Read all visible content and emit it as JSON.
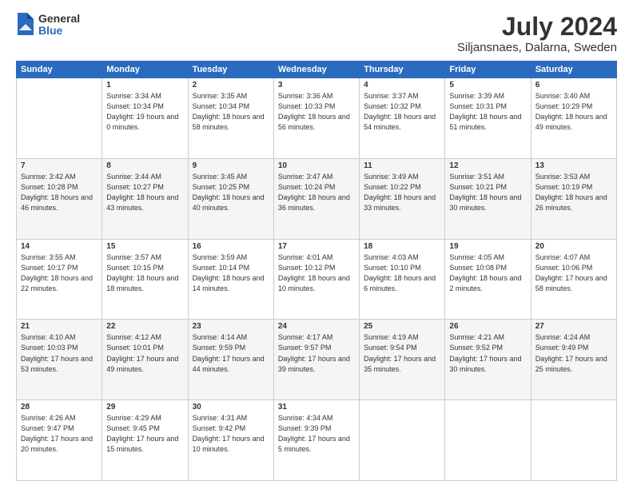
{
  "logo": {
    "general": "General",
    "blue": "Blue"
  },
  "header": {
    "title": "July 2024",
    "subtitle": "Siljansnaes, Dalarna, Sweden"
  },
  "weekdays": [
    "Sunday",
    "Monday",
    "Tuesday",
    "Wednesday",
    "Thursday",
    "Friday",
    "Saturday"
  ],
  "weeks": [
    [
      {
        "day": "",
        "sunrise": "",
        "sunset": "",
        "daylight": ""
      },
      {
        "day": "1",
        "sunrise": "Sunrise: 3:34 AM",
        "sunset": "Sunset: 10:34 PM",
        "daylight": "Daylight: 19 hours and 0 minutes."
      },
      {
        "day": "2",
        "sunrise": "Sunrise: 3:35 AM",
        "sunset": "Sunset: 10:34 PM",
        "daylight": "Daylight: 18 hours and 58 minutes."
      },
      {
        "day": "3",
        "sunrise": "Sunrise: 3:36 AM",
        "sunset": "Sunset: 10:33 PM",
        "daylight": "Daylight: 18 hours and 56 minutes."
      },
      {
        "day": "4",
        "sunrise": "Sunrise: 3:37 AM",
        "sunset": "Sunset: 10:32 PM",
        "daylight": "Daylight: 18 hours and 54 minutes."
      },
      {
        "day": "5",
        "sunrise": "Sunrise: 3:39 AM",
        "sunset": "Sunset: 10:31 PM",
        "daylight": "Daylight: 18 hours and 51 minutes."
      },
      {
        "day": "6",
        "sunrise": "Sunrise: 3:40 AM",
        "sunset": "Sunset: 10:29 PM",
        "daylight": "Daylight: 18 hours and 49 minutes."
      }
    ],
    [
      {
        "day": "7",
        "sunrise": "Sunrise: 3:42 AM",
        "sunset": "Sunset: 10:28 PM",
        "daylight": "Daylight: 18 hours and 46 minutes."
      },
      {
        "day": "8",
        "sunrise": "Sunrise: 3:44 AM",
        "sunset": "Sunset: 10:27 PM",
        "daylight": "Daylight: 18 hours and 43 minutes."
      },
      {
        "day": "9",
        "sunrise": "Sunrise: 3:45 AM",
        "sunset": "Sunset: 10:25 PM",
        "daylight": "Daylight: 18 hours and 40 minutes."
      },
      {
        "day": "10",
        "sunrise": "Sunrise: 3:47 AM",
        "sunset": "Sunset: 10:24 PM",
        "daylight": "Daylight: 18 hours and 36 minutes."
      },
      {
        "day": "11",
        "sunrise": "Sunrise: 3:49 AM",
        "sunset": "Sunset: 10:22 PM",
        "daylight": "Daylight: 18 hours and 33 minutes."
      },
      {
        "day": "12",
        "sunrise": "Sunrise: 3:51 AM",
        "sunset": "Sunset: 10:21 PM",
        "daylight": "Daylight: 18 hours and 30 minutes."
      },
      {
        "day": "13",
        "sunrise": "Sunrise: 3:53 AM",
        "sunset": "Sunset: 10:19 PM",
        "daylight": "Daylight: 18 hours and 26 minutes."
      }
    ],
    [
      {
        "day": "14",
        "sunrise": "Sunrise: 3:55 AM",
        "sunset": "Sunset: 10:17 PM",
        "daylight": "Daylight: 18 hours and 22 minutes."
      },
      {
        "day": "15",
        "sunrise": "Sunrise: 3:57 AM",
        "sunset": "Sunset: 10:15 PM",
        "daylight": "Daylight: 18 hours and 18 minutes."
      },
      {
        "day": "16",
        "sunrise": "Sunrise: 3:59 AM",
        "sunset": "Sunset: 10:14 PM",
        "daylight": "Daylight: 18 hours and 14 minutes."
      },
      {
        "day": "17",
        "sunrise": "Sunrise: 4:01 AM",
        "sunset": "Sunset: 10:12 PM",
        "daylight": "Daylight: 18 hours and 10 minutes."
      },
      {
        "day": "18",
        "sunrise": "Sunrise: 4:03 AM",
        "sunset": "Sunset: 10:10 PM",
        "daylight": "Daylight: 18 hours and 6 minutes."
      },
      {
        "day": "19",
        "sunrise": "Sunrise: 4:05 AM",
        "sunset": "Sunset: 10:08 PM",
        "daylight": "Daylight: 18 hours and 2 minutes."
      },
      {
        "day": "20",
        "sunrise": "Sunrise: 4:07 AM",
        "sunset": "Sunset: 10:06 PM",
        "daylight": "Daylight: 17 hours and 58 minutes."
      }
    ],
    [
      {
        "day": "21",
        "sunrise": "Sunrise: 4:10 AM",
        "sunset": "Sunset: 10:03 PM",
        "daylight": "Daylight: 17 hours and 53 minutes."
      },
      {
        "day": "22",
        "sunrise": "Sunrise: 4:12 AM",
        "sunset": "Sunset: 10:01 PM",
        "daylight": "Daylight: 17 hours and 49 minutes."
      },
      {
        "day": "23",
        "sunrise": "Sunrise: 4:14 AM",
        "sunset": "Sunset: 9:59 PM",
        "daylight": "Daylight: 17 hours and 44 minutes."
      },
      {
        "day": "24",
        "sunrise": "Sunrise: 4:17 AM",
        "sunset": "Sunset: 9:57 PM",
        "daylight": "Daylight: 17 hours and 39 minutes."
      },
      {
        "day": "25",
        "sunrise": "Sunrise: 4:19 AM",
        "sunset": "Sunset: 9:54 PM",
        "daylight": "Daylight: 17 hours and 35 minutes."
      },
      {
        "day": "26",
        "sunrise": "Sunrise: 4:21 AM",
        "sunset": "Sunset: 9:52 PM",
        "daylight": "Daylight: 17 hours and 30 minutes."
      },
      {
        "day": "27",
        "sunrise": "Sunrise: 4:24 AM",
        "sunset": "Sunset: 9:49 PM",
        "daylight": "Daylight: 17 hours and 25 minutes."
      }
    ],
    [
      {
        "day": "28",
        "sunrise": "Sunrise: 4:26 AM",
        "sunset": "Sunset: 9:47 PM",
        "daylight": "Daylight: 17 hours and 20 minutes."
      },
      {
        "day": "29",
        "sunrise": "Sunrise: 4:29 AM",
        "sunset": "Sunset: 9:45 PM",
        "daylight": "Daylight: 17 hours and 15 minutes."
      },
      {
        "day": "30",
        "sunrise": "Sunrise: 4:31 AM",
        "sunset": "Sunset: 9:42 PM",
        "daylight": "Daylight: 17 hours and 10 minutes."
      },
      {
        "day": "31",
        "sunrise": "Sunrise: 4:34 AM",
        "sunset": "Sunset: 9:39 PM",
        "daylight": "Daylight: 17 hours and 5 minutes."
      },
      {
        "day": "",
        "sunrise": "",
        "sunset": "",
        "daylight": ""
      },
      {
        "day": "",
        "sunrise": "",
        "sunset": "",
        "daylight": ""
      },
      {
        "day": "",
        "sunrise": "",
        "sunset": "",
        "daylight": ""
      }
    ]
  ]
}
